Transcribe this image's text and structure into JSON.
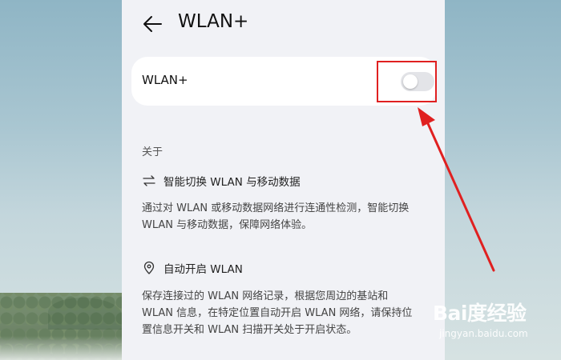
{
  "header": {
    "back_icon": "arrow-left-icon",
    "title": "WLAN+"
  },
  "toggle_card": {
    "label": "WLAN+",
    "toggle_state": "off"
  },
  "about": {
    "section_label": "关于",
    "features": [
      {
        "icon": "swap-arrows-icon",
        "title": "智能切换 WLAN 与移动数据",
        "description_line1": "通过对 WLAN 或移动数据网络进行连通性检测，智能切换",
        "description_line2": "WLAN 与移动数据，保障网络体验。"
      },
      {
        "icon": "location-pin-icon",
        "title": "自动开启 WLAN",
        "description_line1": "保存连接过的 WLAN 网络记录，根据您周边的基站和",
        "description_line2": "WLAN 信息，在特定位置自动开启 WLAN 网络，请保持位",
        "description_line3": "置信息开关和 WLAN 扫描开关处于开启状态。"
      }
    ]
  },
  "annotation": {
    "color": "#e02020"
  },
  "watermark": {
    "logo": "Bai度经验",
    "url": "jingyan.baidu.com"
  }
}
